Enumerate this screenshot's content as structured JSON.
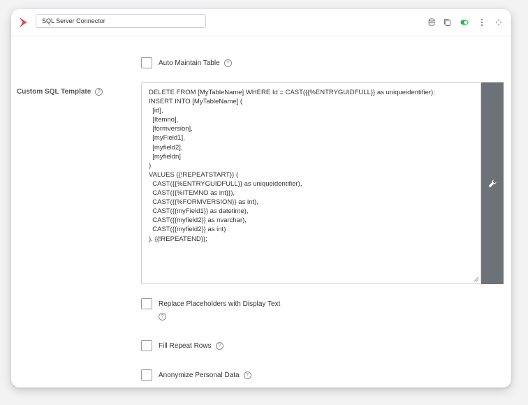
{
  "header": {
    "connector_name": "SQL Server Connector",
    "icons": [
      "database-icon",
      "copy-icon",
      "toggle-icon",
      "more-vert-icon",
      "move-icon"
    ],
    "toggle_color": "#2bb24c",
    "brand_color": "#d9534f"
  },
  "options": {
    "auto_maintain": {
      "label": "Auto Maintain Table",
      "help": "?"
    },
    "replace_placeholders": {
      "label": "Replace Placeholders with Display Text",
      "help": "?"
    },
    "fill_repeat": {
      "label": "Fill Repeat Rows",
      "help": "?"
    },
    "anonymize": {
      "label": "Anonymize Personal Data",
      "help": "?"
    }
  },
  "sql": {
    "label": "Custom SQL Template",
    "help": "?",
    "lines": [
      "DELETE FROM [MyTableName] WHERE Id = CAST({{%ENTRYGUIDFULL}} as uniqueidentifier);",
      "INSERT INTO [MyTableName] (",
      "  [id],",
      "  [Itemno],",
      "  [formversion],",
      "  [myField1],",
      "  [myfield2],",
      "  [myfieldn]",
      ")",
      "VALUES {{!REPEATSTART}} (",
      "  CAST({{%ENTRYGUIDFULL}} as uniqueidentifier),",
      "  CAST({{%ITEMNO as int}}),",
      "  CAST({{%FORMVERSION}} as int),",
      "  CAST({{myField1}} as datetime),",
      "  CAST({{myfield2}} as nvarchar),",
      "  CAST({{myfield2}} as int)",
      "), {{!REPEATEND}};"
    ],
    "side_button_icon": "wrench-icon"
  }
}
